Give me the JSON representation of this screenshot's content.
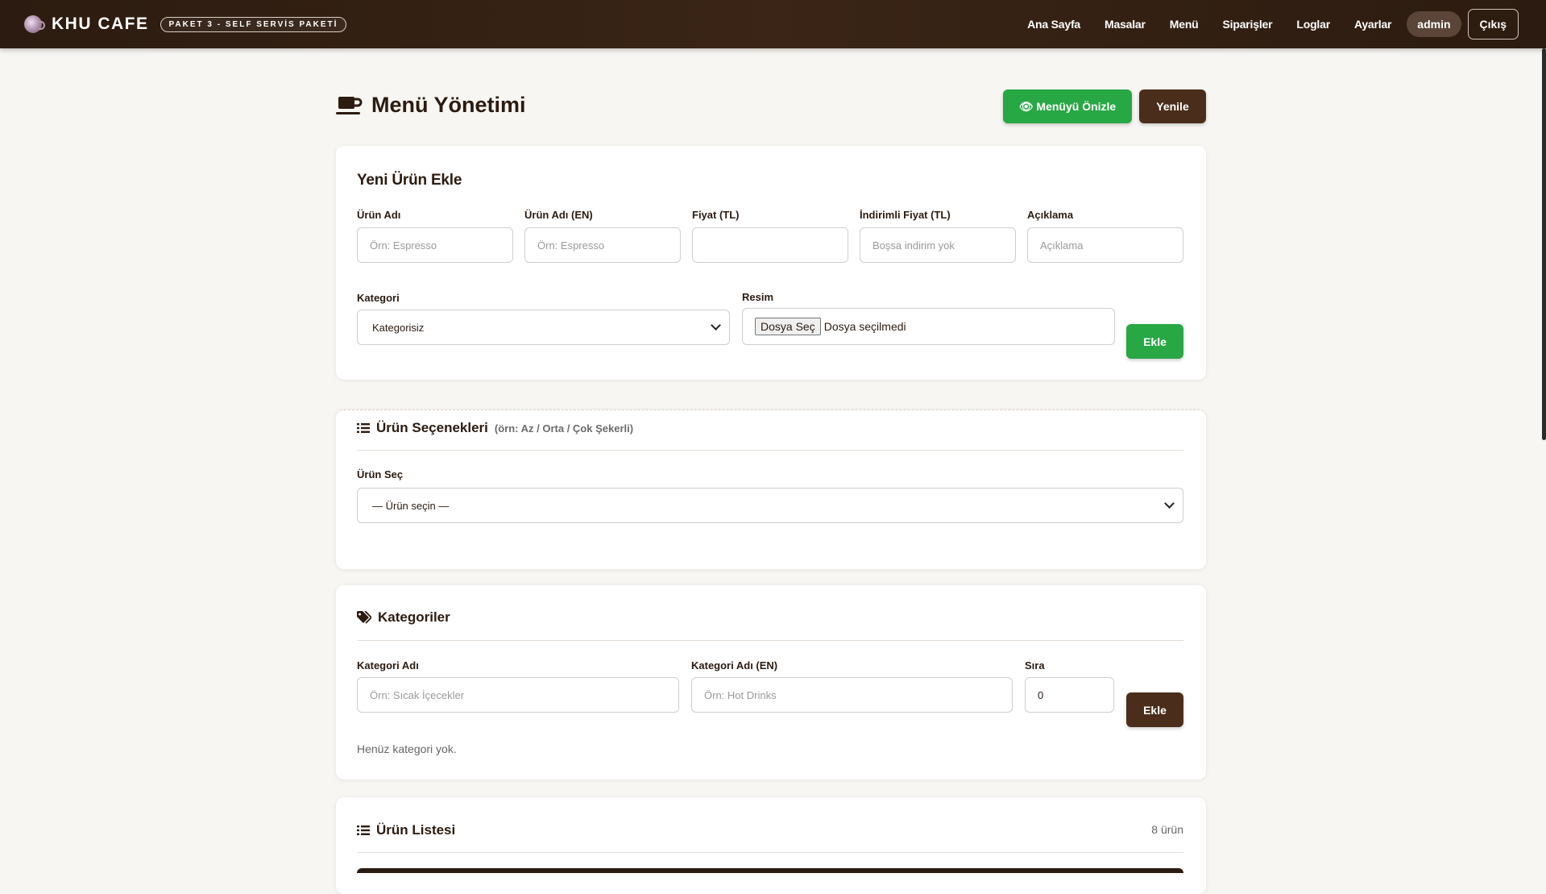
{
  "header": {
    "brand_name": "KHU CAFE",
    "badge": "PAKET 3 - SELF SERVİS PAKETİ",
    "nav": [
      "Ana Sayfa",
      "Masalar",
      "Menü",
      "Siparişler",
      "Loglar",
      "Ayarlar"
    ],
    "user": "admin",
    "logout": "Çıkış"
  },
  "page": {
    "title": "Menü Yönetimi",
    "preview_button": "👁 Menüyü Önizle",
    "refresh_button": "Yenile"
  },
  "new_product": {
    "heading": "Yeni Ürün Ekle",
    "fields": [
      {
        "label": "Ürün Adı",
        "placeholder": "Örn: Espresso"
      },
      {
        "label": "Ürün Adı (EN)",
        "placeholder": "Örn: Espresso"
      },
      {
        "label": "Fiyat (TL)",
        "placeholder": ""
      },
      {
        "label": "İndirimli Fiyat (TL)",
        "placeholder": "Boşsa indirim yok"
      },
      {
        "label": "Açıklama",
        "placeholder": "Açıklama"
      }
    ],
    "category_label": "Kategori",
    "category_value": "Kategorisiz",
    "image_label": "Resim",
    "file_button": "Dosya Seç",
    "file_status": "Dosya seçilmedi",
    "add_button": "Ekle"
  },
  "options": {
    "heading": "Ürün Seçenekleri",
    "hint": "(örn: Az / Orta / Çok Şekerli)",
    "product_label": "Ürün Seç",
    "product_value": "— Ürün seçin —"
  },
  "categories": {
    "heading": "Kategoriler",
    "name_label": "Kategori Adı",
    "name_placeholder": "Örn: Sıcak İçecekler",
    "name_en_label": "Kategori Adı (EN)",
    "name_en_placeholder": "Örn: Hot Drinks",
    "order_label": "Sıra",
    "order_value": "0",
    "add_button": "Ekle",
    "empty_text": "Henüz kategori yok."
  },
  "product_list": {
    "heading": "Ürün Listesi",
    "count": "8 ürün"
  },
  "colors": {
    "nav_bg": "#2c1b10",
    "accent_brown": "#4a2e1b",
    "accent_green": "#28a745",
    "page_bg": "#f8f6f2"
  }
}
